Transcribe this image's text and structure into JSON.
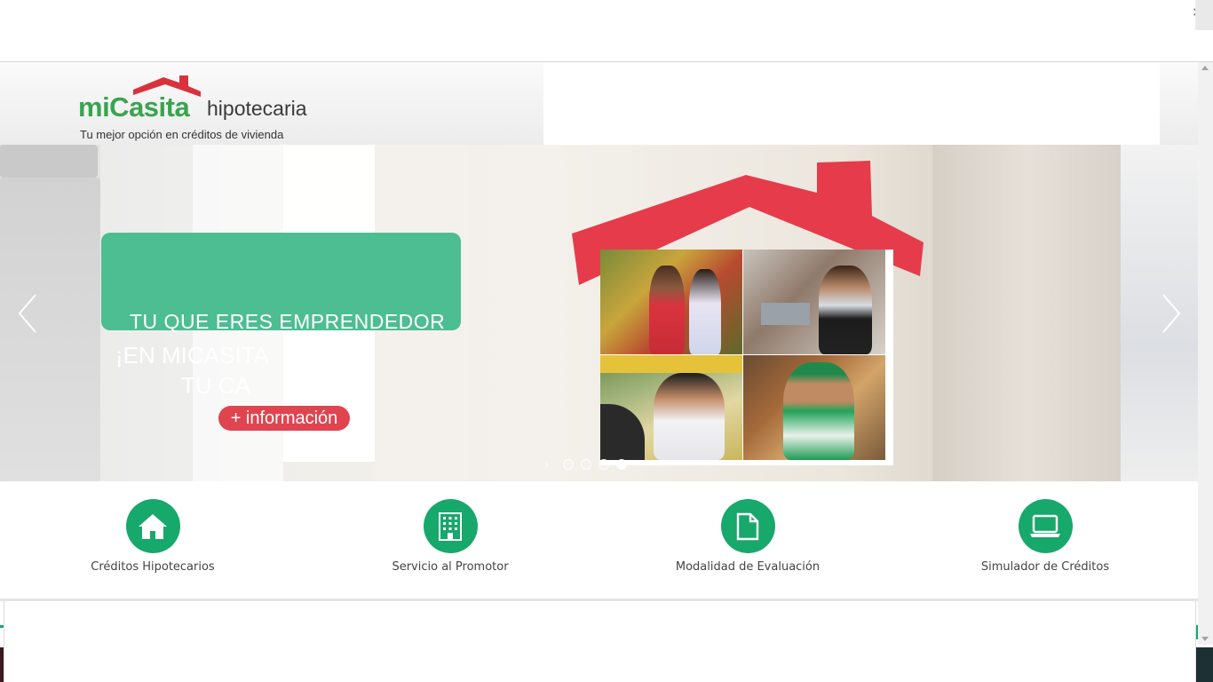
{
  "topbar": {
    "close_glyph": "×"
  },
  "brand": {
    "name_main": "miCasita",
    "name_secondary": "hipotecaria",
    "tagline": "Tu mejor opción en créditos de vivienda",
    "primary_color": "#3aa350",
    "roof_color": "#d9323d"
  },
  "hero": {
    "line1": "TU QUE ERES EMPRENDEDOR",
    "line2": "¡EN MICASITA",
    "line3": "TU CA",
    "cta_label": "+ información",
    "prev_icon": "chevron-left-icon",
    "next_icon": "chevron-right-icon",
    "slide_count": 5,
    "active_slide": 4
  },
  "services": [
    {
      "label": "Créditos Hipotecarios",
      "icon": "home-icon"
    },
    {
      "label": "Servicio al Promotor",
      "icon": "building-icon"
    },
    {
      "label": "Modalidad de Evaluación",
      "icon": "document-icon"
    },
    {
      "label": "Simulador de Créditos",
      "icon": "laptop-icon"
    }
  ],
  "colors": {
    "service_green": "#17a86b",
    "cta_red": "#e0444f",
    "box_green": "#4dbd92"
  }
}
